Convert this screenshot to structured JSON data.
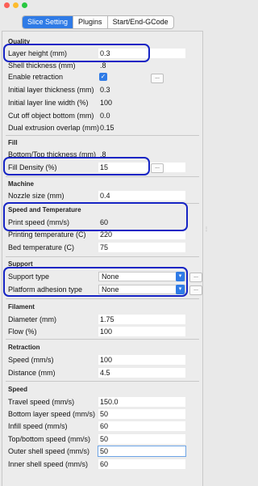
{
  "tabs": [
    "Slice Setting",
    "Plugins",
    "Start/End-GCode"
  ],
  "active_tab": "Slice Setting",
  "sections": {
    "quality": "Quality",
    "fill": "Fill",
    "machine": "Machine",
    "speed_temp": "Speed and Temperature",
    "support": "Support",
    "filament": "Filament",
    "retraction": "Retraction",
    "speed": "Speed"
  },
  "fields": {
    "layer_height": {
      "label": "Layer height (mm)",
      "value": "0.3"
    },
    "shell_thickness": {
      "label": "Shell thickness (mm)",
      "value": ".8"
    },
    "enable_retraction": {
      "label": "Enable retraction",
      "checked": true
    },
    "initial_layer_thickness": {
      "label": "Initial layer thickness (mm)",
      "value": "0.3"
    },
    "initial_layer_line_width": {
      "label": "Initial layer line width (%)",
      "value": "100"
    },
    "cut_off_object_bottom": {
      "label": "Cut off object bottom (mm)",
      "value": "0.0"
    },
    "dual_extrusion_overlap": {
      "label": "Dual extrusion overlap (mm)",
      "value": "0.15"
    },
    "bottom_top_thickness": {
      "label": "Bottom/Top thickness (mm)",
      "value": ".8"
    },
    "fill_density": {
      "label": "Fill Density (%)",
      "value": "15"
    },
    "nozzle_size": {
      "label": "Nozzle size (mm)",
      "value": "0.4"
    },
    "print_speed": {
      "label": "Print speed (mm/s)",
      "value": "60"
    },
    "printing_temperature": {
      "label": "Printing temperature (C)",
      "value": "220"
    },
    "bed_temperature": {
      "label": "Bed temperature (C)",
      "value": "75"
    },
    "support_type": {
      "label": "Support type",
      "value": "None"
    },
    "platform_adhesion_type": {
      "label": "Platform adhesion type",
      "value": "None"
    },
    "diameter": {
      "label": "Diameter (mm)",
      "value": "1.75"
    },
    "flow": {
      "label": "Flow (%)",
      "value": "100"
    },
    "retraction_speed": {
      "label": "Speed (mm/s)",
      "value": "100"
    },
    "retraction_distance": {
      "label": "Distance (mm)",
      "value": "4.5"
    },
    "travel_speed": {
      "label": "Travel speed (mm/s)",
      "value": "150.0"
    },
    "bottom_layer_speed": {
      "label": "Bottom layer speed (mm/s)",
      "value": "50"
    },
    "infill_speed": {
      "label": "Infill speed (mm/s)",
      "value": "60"
    },
    "top_bottom_speed": {
      "label": "Top/bottom speed (mm/s)",
      "value": "50"
    },
    "outer_shell_speed": {
      "label": "Outer shell speed (mm/s)",
      "value": "50"
    },
    "inner_shell_speed": {
      "label": "Inner shell speed (mm/s)",
      "value": "60"
    }
  },
  "more_button_label": "...",
  "checkmark_glyph": "✓",
  "dropdown_arrow_glyph": "▾",
  "colors": {
    "accent": "#2f7be6",
    "highlight": "#1624c4",
    "window_close": "#fc5f57",
    "window_minimize": "#fdbc2e",
    "window_zoom": "#28c840"
  }
}
